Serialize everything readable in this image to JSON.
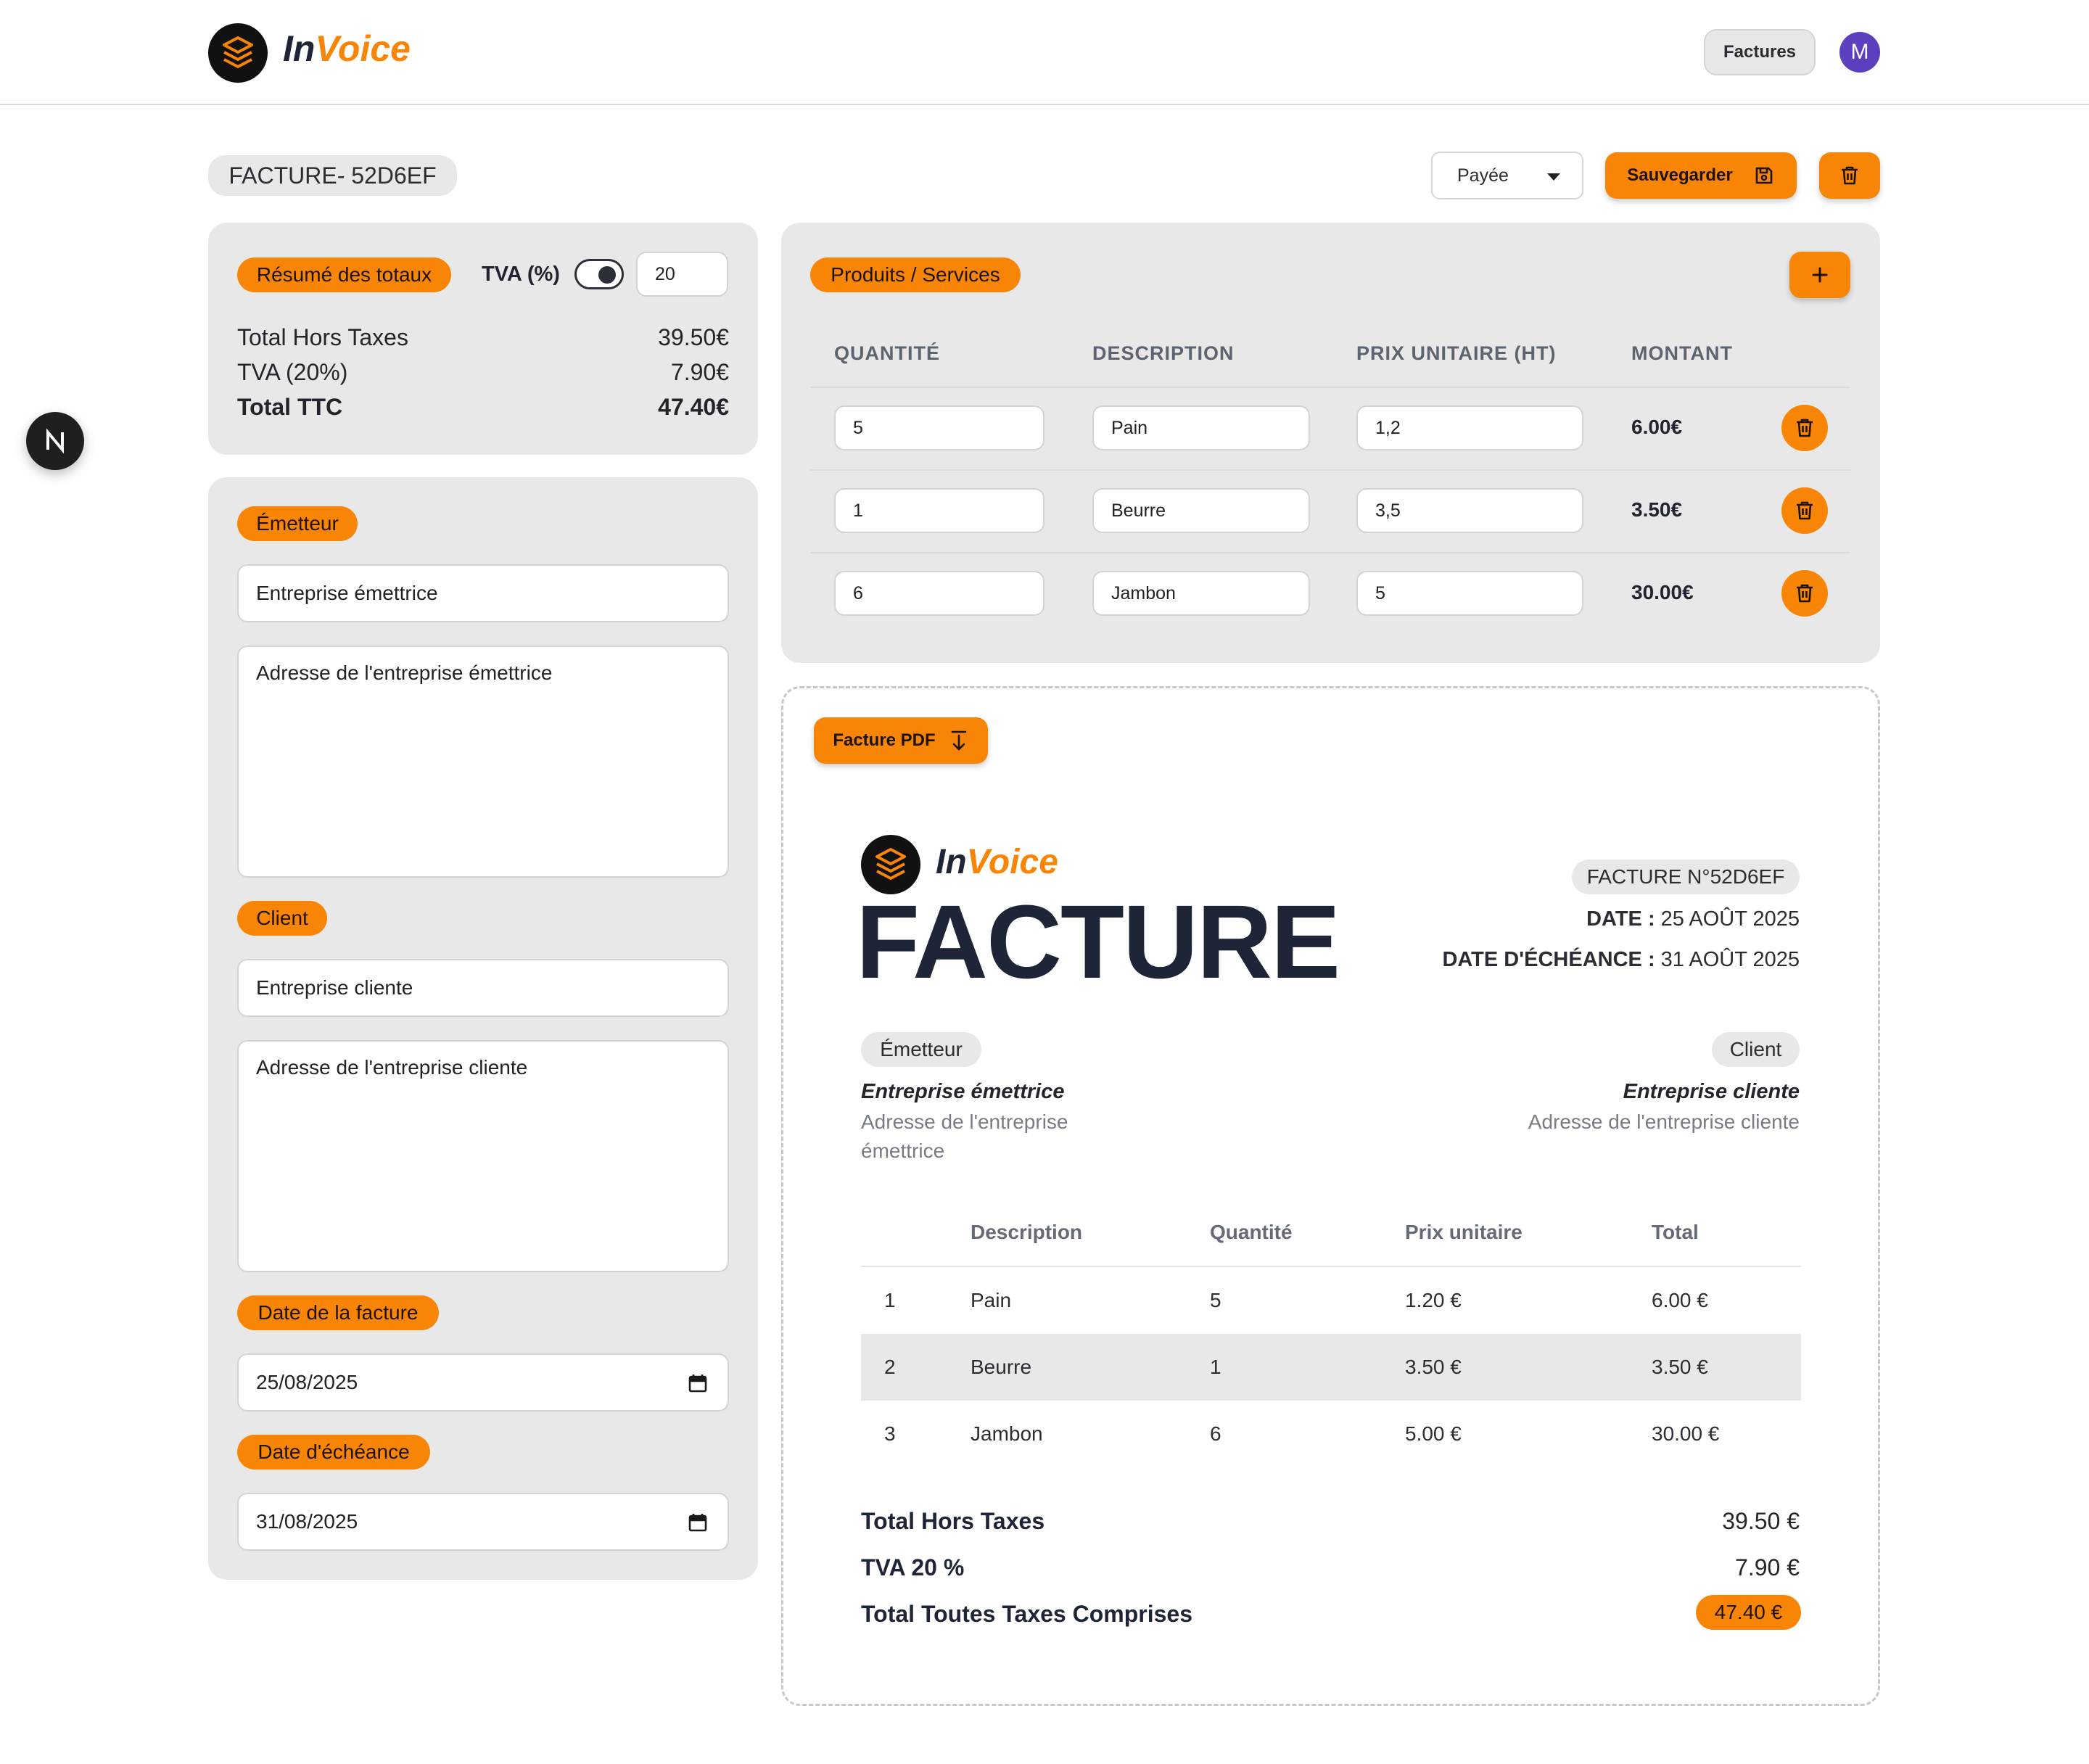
{
  "header": {
    "brand_in": "In",
    "brand_voice": "Voice",
    "nav_button": "Factures",
    "avatar_letter": "M"
  },
  "toolbar": {
    "invoice_label": "FACTURE- 52D6EF",
    "status": "Payée",
    "save_label": "Sauvegarder"
  },
  "totals": {
    "badge": "Résumé des totaux",
    "tva_label": "TVA (%)",
    "tva_value": "20",
    "ht_label": "Total Hors Taxes",
    "ht_value": "39.50€",
    "tva_line_label": "TVA (20%)",
    "tva_line_value": "7.90€",
    "ttc_label": "Total TTC",
    "ttc_value": "47.40€"
  },
  "emitter": {
    "badge": "Émetteur",
    "company": "Entreprise émettrice",
    "address": "Adresse de l'entreprise émettrice"
  },
  "client": {
    "badge": "Client",
    "company": "Entreprise cliente",
    "address": "Adresse de l'entreprise cliente"
  },
  "dates": {
    "invoice_badge": "Date de la facture",
    "invoice_value": "25/08/2025",
    "due_badge": "Date d'échéance",
    "due_value": "31/08/2025"
  },
  "products": {
    "badge": "Produits / Services",
    "add_label": "+",
    "columns": [
      "QUANTITÉ",
      "DESCRIPTION",
      "PRIX UNITAIRE (HT)",
      "MONTANT"
    ],
    "rows": [
      {
        "qty": "5",
        "desc": "Pain",
        "price": "1,2",
        "amount": "6.00€"
      },
      {
        "qty": "1",
        "desc": "Beurre",
        "price": "3,5",
        "amount": "3.50€"
      },
      {
        "qty": "6",
        "desc": "Jambon",
        "price": "5",
        "amount": "30.00€"
      }
    ]
  },
  "preview": {
    "pdf_button": "Facture PDF",
    "brand_in": "In",
    "brand_voice": "Voice",
    "title": "FACTURE",
    "number": "FACTURE N°52D6EF",
    "date_label": "DATE :",
    "date_value": "25 AOÛT 2025",
    "due_label": "DATE D'ÉCHÉANCE :",
    "due_value": "31 AOÛT 2025",
    "emitter_badge": "Émetteur",
    "emitter_company": "Entreprise émettrice",
    "emitter_address_1": "Adresse de l'entreprise",
    "emitter_address_2": "émettrice",
    "client_badge": "Client",
    "client_company": "Entreprise cliente",
    "client_address": "Adresse de l'entreprise cliente",
    "columns": [
      "Description",
      "Quantité",
      "Prix unitaire",
      "Total"
    ],
    "rows": [
      {
        "n": "1",
        "desc": "Pain",
        "qty": "5",
        "price": "1.20 €",
        "total": "6.00 €"
      },
      {
        "n": "2",
        "desc": "Beurre",
        "qty": "1",
        "price": "3.50 €",
        "total": "3.50 €"
      },
      {
        "n": "3",
        "desc": "Jambon",
        "qty": "6",
        "price": "5.00 €",
        "total": "30.00 €"
      }
    ],
    "ht_label": "Total Hors Taxes",
    "ht_value": "39.50 €",
    "tva_label": "TVA 20 %",
    "tva_value": "7.90 €",
    "ttc_label": "Total Toutes Taxes Comprises",
    "ttc_value": "47.40 €"
  },
  "colors": {
    "accent": "#f98506",
    "navy": "#1e2537",
    "panel": "#e8e8e8",
    "avatar": "#5b3fbf"
  },
  "icons": [
    "logo-icon",
    "chevron-down-icon",
    "save-icon",
    "trash-icon",
    "plus-icon",
    "download-icon",
    "calendar-icon",
    "next-js-icon"
  ]
}
